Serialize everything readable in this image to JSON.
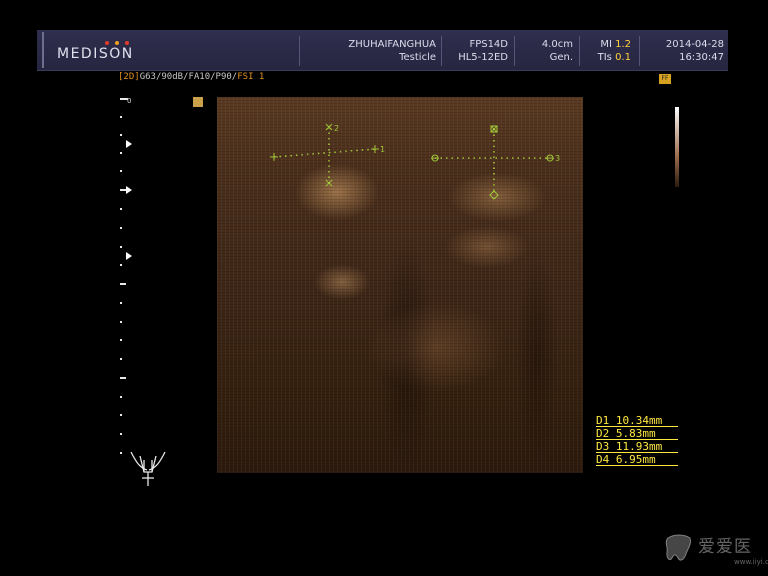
{
  "header": {
    "logo": "MEDISON",
    "logo_dot_colors": [
      "#e03a2a",
      "#f0a020",
      "#e03a2a"
    ],
    "institution": "ZHUHAIFANGHUA",
    "application": "Testicle",
    "preset": "FPS14D",
    "probe": "HL5-12ED",
    "depth": "4.0cm",
    "frequency": "Gen.",
    "mi_label": "MI",
    "mi_value": "1.2",
    "tis_label": "TIs",
    "tis_value": "0.1",
    "date": "2014-04-28",
    "time": "16:30:47"
  },
  "params": {
    "mode": "[2D]",
    "settings": "G63/90dB/FA10/P90/",
    "fsi": "FSI 1"
  },
  "ruler": {
    "zero_label": "0"
  },
  "calipers": {
    "c1": "1",
    "c2": "2",
    "c3": "3"
  },
  "measurements": [
    {
      "label": "D1",
      "value": "10.34mm"
    },
    {
      "label": "D2",
      "value": "5.83mm"
    },
    {
      "label": "D3",
      "value": "11.93mm"
    },
    {
      "label": "D4",
      "value": "6.95mm"
    }
  ],
  "orientation_badge": "FF",
  "colors": {
    "header_bg": "#2c2c4a",
    "accent_orange": "#e09020",
    "measurement_yellow": "#ffe840",
    "caliper_green": "#9acd32"
  },
  "icons": {
    "probe": "linear-probe-icon",
    "watermark_logo": "tooth-logo-icon"
  },
  "watermark": {
    "text": "爱爱医",
    "url": "www.iiyi.com"
  }
}
